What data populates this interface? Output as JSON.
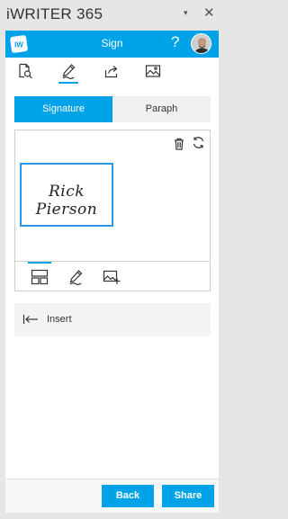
{
  "pane": {
    "title": "iWRITER 365",
    "menu_glyph": "▾",
    "close_glyph": "✕"
  },
  "app": {
    "title": "Sign",
    "help_glyph": "?",
    "logo_text": "IW"
  },
  "toolbar": {
    "icons": [
      "document-search-icon",
      "pen-icon",
      "share-icon",
      "image-icon"
    ],
    "active": "pen-icon"
  },
  "tabs": [
    {
      "label": "Signature",
      "selected": true
    },
    {
      "label": "Paraph",
      "selected": false
    }
  ],
  "signature": {
    "text": "Rick Pierson"
  },
  "signature_tools": {
    "icons": [
      "layout-grid-icon",
      "pen-icon",
      "add-image-icon"
    ],
    "active": "layout-grid-icon"
  },
  "insert": {
    "label": "Insert"
  },
  "footer": {
    "back": "Back",
    "share": "Share"
  },
  "colors": {
    "accent": "#00a2e8",
    "frame": "#2b97e6"
  }
}
